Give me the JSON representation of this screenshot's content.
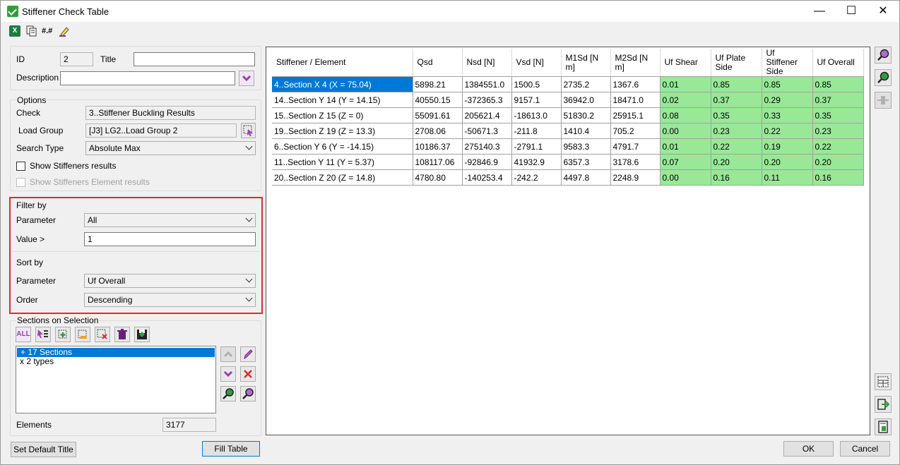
{
  "window": {
    "title": "Stiffener Check Table",
    "minimize": "—",
    "maximize": "☐",
    "close": "✕"
  },
  "toolbar": {
    "icons": [
      "excel-icon",
      "copy-icon",
      "number-format-icon",
      "clear-icon"
    ],
    "number_format_label": "#.#"
  },
  "id_row": {
    "id_label": "ID",
    "id_value": "2",
    "title_label": "Title",
    "title_value": "",
    "description_label": "Description",
    "description_value": ""
  },
  "options": {
    "legend": "Options",
    "check_label": "Check",
    "check_value": "3..Stiffener Buckling Results",
    "load_group_label": "Load Group",
    "load_group_value": "[J3] LG2..Load Group 2",
    "search_type_label": "Search Type",
    "search_type_value": "Absolute Max",
    "show_stiffeners_label": "Show Stiffeners results",
    "show_stiffeners_element_label": "Show Stiffeners Element results"
  },
  "filter": {
    "legend": "Filter by",
    "parameter_label": "Parameter",
    "parameter_value": "All",
    "value_label": "Value >",
    "value_value": "1"
  },
  "sort": {
    "legend": "Sort by",
    "parameter_label": "Parameter",
    "parameter_value": "Uf Overall",
    "order_label": "Order",
    "order_value": "Descending"
  },
  "sections": {
    "legend": "Sections on Selection",
    "all_label": "ALL",
    "items": [
      "+ 17 Sections",
      "x 2 types"
    ],
    "elements_label": "Elements",
    "elements_value": "3177"
  },
  "buttons": {
    "set_default_title": "Set Default Title",
    "fill_table": "Fill Table",
    "ok": "OK",
    "cancel": "Cancel"
  },
  "table": {
    "headers": [
      "Stiffener / Element",
      "Qsd",
      "Nsd [N]",
      "Vsd [N]",
      "M1Sd [N m]",
      "M2Sd [N m]",
      "Uf Shear",
      "Uf Plate Side",
      "Uf Stiffener Side",
      "Uf Overall"
    ],
    "rows": [
      [
        "4..Section X 4 (X = 75.04)",
        "5898.21",
        "1384551.0",
        "1500.5",
        "2735.2",
        "1367.6",
        "0.01",
        "0.85",
        "0.85",
        "0.85"
      ],
      [
        "14..Section Y 14 (Y = 14.15)",
        "40550.15",
        "-372365.3",
        "9157.1",
        "36942.0",
        "18471.0",
        "0.02",
        "0.37",
        "0.29",
        "0.37"
      ],
      [
        "15..Section Z 15 (Z = 0)",
        "55091.61",
        "205621.4",
        "-18613.0",
        "51830.2",
        "25915.1",
        "0.08",
        "0.35",
        "0.33",
        "0.35"
      ],
      [
        "19..Section Z 19 (Z = 13.3)",
        "2708.06",
        "-50671.3",
        "-211.8",
        "1410.4",
        "705.2",
        "0.00",
        "0.23",
        "0.22",
        "0.23"
      ],
      [
        "6..Section Y 6 (Y = -14.15)",
        "10186.37",
        "275140.3",
        "-2791.1",
        "9583.3",
        "4791.7",
        "0.01",
        "0.22",
        "0.19",
        "0.22"
      ],
      [
        "11..Section Y 11 (Y = 5.37)",
        "108117.06",
        "-92846.9",
        "41932.9",
        "6357.3",
        "3178.6",
        "0.07",
        "0.20",
        "0.20",
        "0.20"
      ],
      [
        "20..Section Z 20 (Z = 14.8)",
        "4780.80",
        "-140253.4",
        "-242.2",
        "4497.8",
        "2248.9",
        "0.00",
        "0.16",
        "0.11",
        "0.16"
      ]
    ]
  },
  "colors": {
    "uf_ok": "#98e898",
    "selection": "#0078d7",
    "highlight_border": "#d32f2f"
  }
}
